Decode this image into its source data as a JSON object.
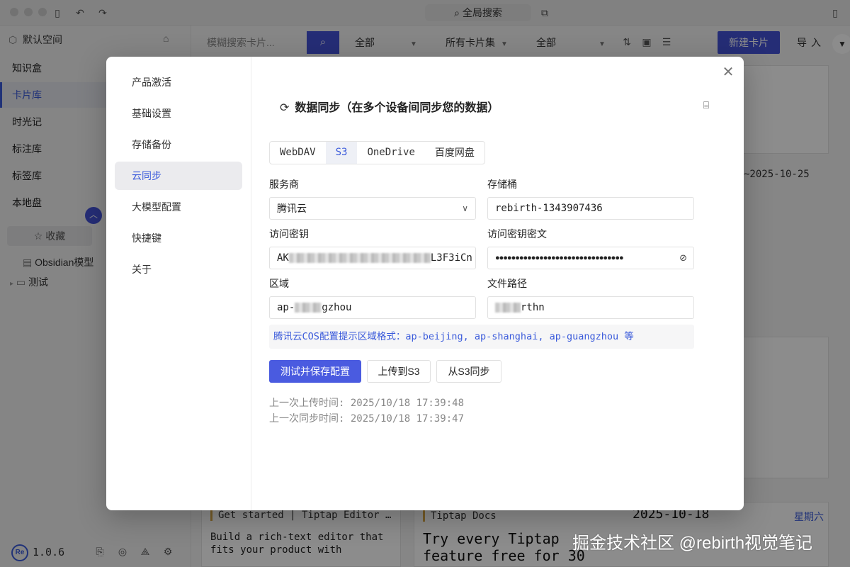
{
  "titlebar": {
    "global_search": "全局搜索"
  },
  "sidebar": {
    "workspace": "默认空间",
    "nav": [
      {
        "label": "知识盒"
      },
      {
        "label": "卡片库"
      },
      {
        "label": "时光记"
      },
      {
        "label": "标注库"
      },
      {
        "label": "标签库"
      },
      {
        "label": "本地盘"
      }
    ],
    "favorites": "收藏",
    "tree": [
      {
        "label": "Obsidian模型"
      },
      {
        "label": "测试"
      }
    ],
    "version": "1.0.6"
  },
  "toolbar": {
    "search_placeholder": "模糊搜索卡片...",
    "filter_all_1": "全部",
    "filter_sets": "所有卡片集",
    "filter_all_2": "全部",
    "new_card": "新建卡片",
    "import": "导入"
  },
  "background_cards": {
    "date_range": "~2025-10-25",
    "card1_title": "Get started | Tiptap Editor …",
    "card1_body": "Build a rich-text editor that fits your product with",
    "card2_title": "Tiptap Docs",
    "card2_body": "Try every Tiptap feature free for 30",
    "card2_date": "2025-10-18",
    "card2_weekday": "星期六"
  },
  "settings_modal": {
    "nav": [
      {
        "label": "产品激活"
      },
      {
        "label": "基础设置"
      },
      {
        "label": "存储备份"
      },
      {
        "label": "云同步"
      },
      {
        "label": "大模型配置"
      },
      {
        "label": "快捷键"
      },
      {
        "label": "关于"
      }
    ],
    "active_nav": "云同步",
    "title": "数据同步（在多个设备间同步您的数据）",
    "tabs": [
      {
        "label": "WebDAV"
      },
      {
        "label": "S3"
      },
      {
        "label": "OneDrive"
      },
      {
        "label": "百度网盘"
      }
    ],
    "active_tab": "S3",
    "fields": {
      "provider_label": "服务商",
      "provider_value": "腾讯云",
      "bucket_label": "存储桶",
      "bucket_value": "rebirth-1343907436",
      "access_key_label": "访问密钥",
      "access_key_prefix": "AK",
      "access_key_suffix": "L3F3iCn",
      "secret_label": "访问密钥密文",
      "secret_value": "●●●●●●●●●●●●●●●●●●●●●●●●●●●●●●●●",
      "region_label": "区域",
      "region_prefix": "ap-",
      "region_suffix": "gzhou",
      "path_label": "文件路径",
      "path_suffix": "rthn"
    },
    "hint": "腾讯云COS配置提示区域格式：ap-beijing, ap-shanghai, ap-guangzhou 等",
    "buttons": {
      "test_save": "测试并保存配置",
      "upload": "上传到S3",
      "sync_from": "从S3同步"
    },
    "last_upload": "上一次上传时间: 2025/10/18 17:39:48",
    "last_sync": "上一次同步时间: 2025/10/18 17:39:47"
  },
  "watermark": "掘金技术社区 @rebirth视觉笔记",
  "colors": {
    "accent": "#4453d8",
    "active_text": "#3b5bdb"
  }
}
